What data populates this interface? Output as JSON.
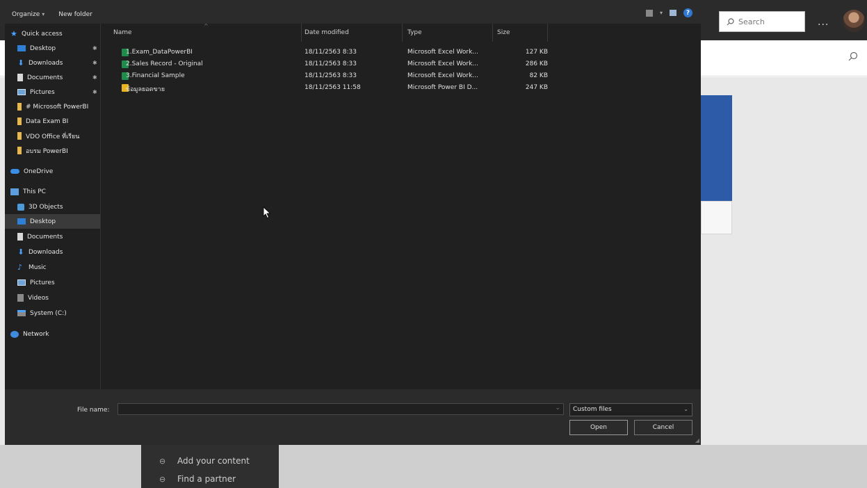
{
  "background": {
    "search_placeholder": "Search",
    "more_label": "...",
    "menu_items": [
      {
        "label": "Add your content",
        "icon": "link-icon"
      },
      {
        "label": "Find a partner",
        "icon": "link-icon"
      }
    ]
  },
  "dialog": {
    "commands": {
      "organize": "Organize",
      "new_folder": "New folder"
    },
    "nav": {
      "quick_access": "Quick access",
      "quick_items": [
        {
          "label": "Desktop",
          "icon": "desktop-icon",
          "pinned": true
        },
        {
          "label": "Downloads",
          "icon": "download-icon",
          "pinned": true
        },
        {
          "label": "Documents",
          "icon": "document-icon",
          "pinned": true
        },
        {
          "label": "Pictures",
          "icon": "pictures-icon",
          "pinned": true
        },
        {
          "label": "# Microsoft PowerBI",
          "icon": "folder-icon"
        },
        {
          "label": "Data Exam BI",
          "icon": "folder-icon"
        },
        {
          "label": "VDO Office ที่เรียน",
          "icon": "folder-icon"
        },
        {
          "label": "อบรม PowerBI",
          "icon": "folder-icon"
        }
      ],
      "onedrive": "OneDrive",
      "this_pc": "This PC",
      "pc_items": [
        {
          "label": "3D Objects",
          "icon": "3d-objects-icon"
        },
        {
          "label": "Desktop",
          "icon": "desktop-icon",
          "selected": true
        },
        {
          "label": "Documents",
          "icon": "document-icon"
        },
        {
          "label": "Downloads",
          "icon": "download-icon"
        },
        {
          "label": "Music",
          "icon": "music-icon"
        },
        {
          "label": "Pictures",
          "icon": "pictures-icon"
        },
        {
          "label": "Videos",
          "icon": "videos-icon"
        },
        {
          "label": "System (C:)",
          "icon": "drive-icon"
        }
      ],
      "network": "Network"
    },
    "columns": {
      "name": "Name",
      "date": "Date modified",
      "type": "Type",
      "size": "Size"
    },
    "files": [
      {
        "name": "1.Exam_DataPowerBI",
        "date": "18/11/2563 8:33",
        "type": "Microsoft Excel Work...",
        "size": "127 KB",
        "kind": "excel"
      },
      {
        "name": "2.Sales Record - Original",
        "date": "18/11/2563 8:33",
        "type": "Microsoft Excel Work...",
        "size": "286 KB",
        "kind": "excel"
      },
      {
        "name": "3.Financial Sample",
        "date": "18/11/2563 8:33",
        "type": "Microsoft Excel Work...",
        "size": "82 KB",
        "kind": "excel"
      },
      {
        "name": "ข้อมูลยอดขาย",
        "date": "18/11/2563 11:58",
        "type": "Microsoft Power BI D...",
        "size": "247 KB",
        "kind": "powerbi"
      }
    ],
    "file_name_label": "File name:",
    "file_name_value": "",
    "file_type": "Custom files",
    "open_label": "Open",
    "cancel_label": "Cancel"
  },
  "colors": {
    "dialog_bg": "#202020",
    "accent_blue": "#2d5ba8",
    "excel_green": "#1f8b4c",
    "pbi_yellow": "#e9b322"
  }
}
